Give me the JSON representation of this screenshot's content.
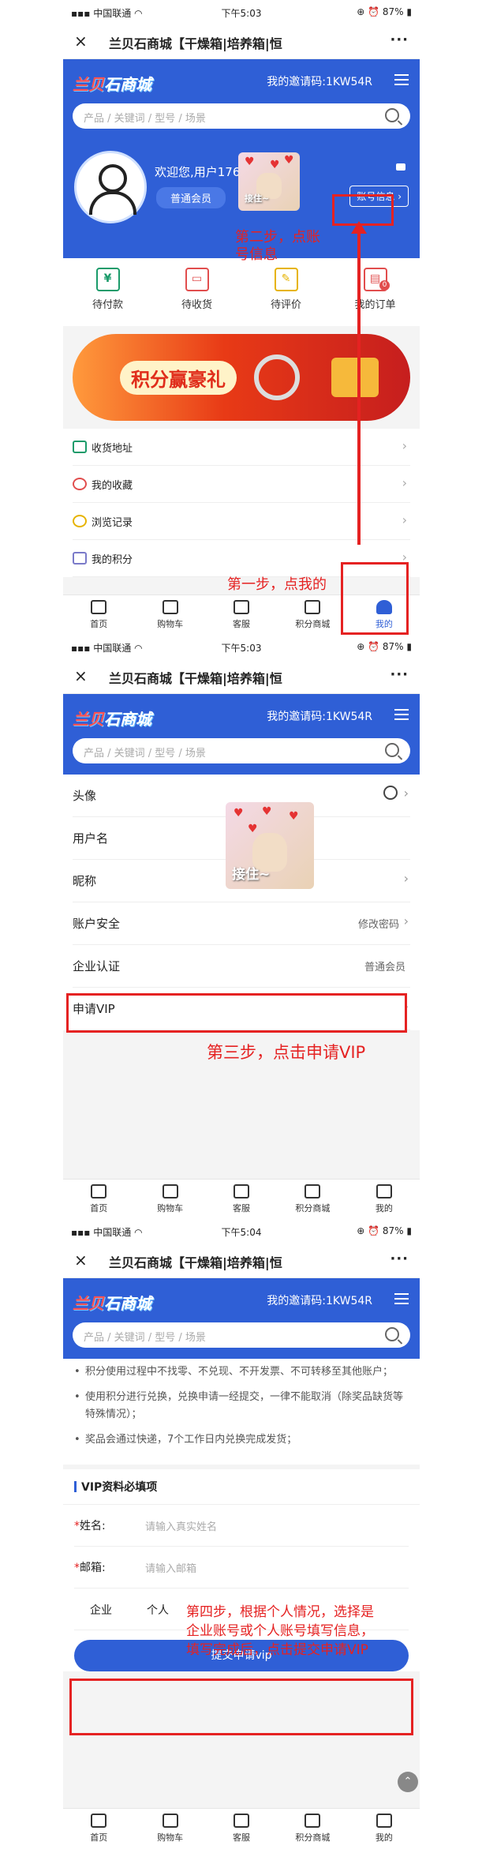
{
  "status": {
    "carrier": "中国联通",
    "signal_icon": "signal-bars-icon",
    "wifi_icon": "wifi-icon",
    "time1": "下午5:03",
    "time2": "下午5:03",
    "time3": "下午5:04",
    "battery": "87%"
  },
  "titlebar": {
    "title": "兰贝石商城【干燥箱|培养箱|恒",
    "close": "×",
    "more": "···"
  },
  "header": {
    "logo_a": "兰贝",
    "logo_b": "石商城",
    "invite": "我的邀请码:1KW54R",
    "search_placeholder": "产品 / 关键词 / 型号 / 场景"
  },
  "profile": {
    "welcome": "欢迎您,用户1760",
    "member_level": "普通会员",
    "account_button": "账号信息 ›"
  },
  "orders": [
    {
      "label": "待付款",
      "icon": "¥",
      "color": "#1a9b6a"
    },
    {
      "label": "待收货",
      "icon": "▭",
      "color": "#e14d4d"
    },
    {
      "label": "待评价",
      "icon": "✎",
      "color": "#e6b300"
    },
    {
      "label": "我的订单",
      "icon": "▤",
      "color": "#e14d4d",
      "badge": "0"
    }
  ],
  "banner": {
    "text": "积分赢豪礼"
  },
  "menu": [
    {
      "label": "收货地址",
      "color": "#1a9b6a"
    },
    {
      "label": "我的收藏",
      "color": "#e14d4d"
    },
    {
      "label": "浏览记录",
      "color": "#e6b300"
    },
    {
      "label": "我的积分",
      "color": "#7a7ac9"
    }
  ],
  "tabs": [
    {
      "label": "首页"
    },
    {
      "label": "购物车"
    },
    {
      "label": "客服"
    },
    {
      "label": "积分商城"
    },
    {
      "label": "我的"
    }
  ],
  "annotations": {
    "step1": "第一步，点我的",
    "step2a": "第二步，点账",
    "step2b": "号信息",
    "step3": "第三步，点击申请VIP",
    "step4a": "第四步，根据个人情况，选择是",
    "step4b": "企业账号或个人账号填写信息，",
    "step4c": "填写完成后，点击提交申请VIP"
  },
  "cat_caption": "接住~",
  "account_rows": [
    {
      "label": "头像",
      "value": ""
    },
    {
      "label": "用户名",
      "value": ""
    },
    {
      "label": "昵称",
      "value": ""
    },
    {
      "label": "账户安全",
      "value": "修改密码"
    },
    {
      "label": "企业认证",
      "value": "普通会员"
    },
    {
      "label": "申请VIP",
      "value": ""
    }
  ],
  "rules": [
    "积分使用过程中不找零、不兑现、不开发票、不可转移至其他账户；",
    "使用积分进行兑换，兑换申请一经提交，一律不能取消（除奖品缺货等特殊情况）；",
    "奖品会通过快递，7个工作日内兑换完成发货；"
  ],
  "form": {
    "heading": "VIP资料必填项",
    "name_label": "姓名:",
    "name_placeholder": "请输入真实姓名",
    "email_label": "邮箱:",
    "email_placeholder": "请输入邮箱",
    "type_enterprise": "企业",
    "type_personal": "个人",
    "submit": "提交申请vip"
  }
}
